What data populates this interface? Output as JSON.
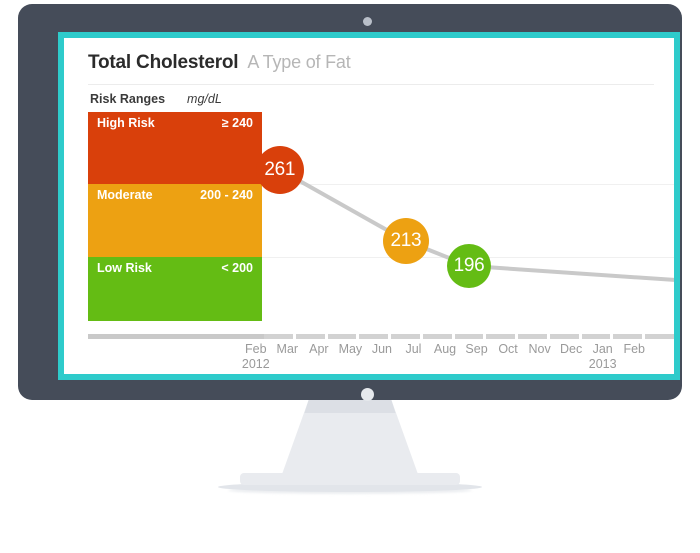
{
  "device": {
    "type": "desktop-monitor",
    "frame_color": "#454c59",
    "bezel_color": "#2ecbcb",
    "stand_color": "#e9ebef"
  },
  "header": {
    "title": "Total Cholesterol",
    "subtitle": "A Type of Fat"
  },
  "legend": {
    "heading": "Risk Ranges",
    "unit": "mg/dL",
    "bands": [
      {
        "label": "High Risk",
        "range": "≥ 240",
        "color": "#d9400b"
      },
      {
        "label": "Moderate",
        "range": "200 - 240",
        "color": "#eda112"
      },
      {
        "label": "Low Risk",
        "range": "< 200",
        "color": "#64bc14"
      }
    ]
  },
  "chart_data": {
    "type": "line",
    "title": "Total Cholesterol",
    "subtitle": "A Type of Fat",
    "xlabel": "",
    "ylabel": "mg/dL",
    "grid": true,
    "legend_position": "left-inline-bands",
    "ylim": [
      150,
      300
    ],
    "gridlines": [
      240,
      200
    ],
    "x": [
      "Feb",
      "Mar",
      "Apr",
      "May",
      "Jun",
      "Jul",
      "Aug",
      "Sep",
      "Oct",
      "Nov",
      "Dec",
      "Jan",
      "Feb"
    ],
    "year_markers": [
      {
        "month": "Feb",
        "year": "2012"
      },
      {
        "month": "Jan",
        "year": "2013"
      }
    ],
    "series": [
      {
        "name": "Total Cholesterol",
        "points": [
          {
            "x": "Feb",
            "value": 261,
            "color": "#d9400b",
            "risk": "High Risk"
          },
          {
            "x": "Jun",
            "value": 213,
            "color": "#eda112",
            "risk": "Moderate"
          },
          {
            "x": "Aug",
            "value": 196,
            "color": "#64bc14",
            "risk": "Low Risk"
          }
        ],
        "line_color": "#c9c9c9"
      }
    ],
    "risk_bands": [
      {
        "label": "High Risk",
        "range": "≥ 240",
        "min": 240,
        "max": 300,
        "color": "#d9400b"
      },
      {
        "label": "Moderate",
        "range": "200 - 240",
        "min": 200,
        "max": 240,
        "color": "#eda112"
      },
      {
        "label": "Low Risk",
        "range": "< 200",
        "min": 150,
        "max": 200,
        "color": "#64bc14"
      }
    ]
  }
}
